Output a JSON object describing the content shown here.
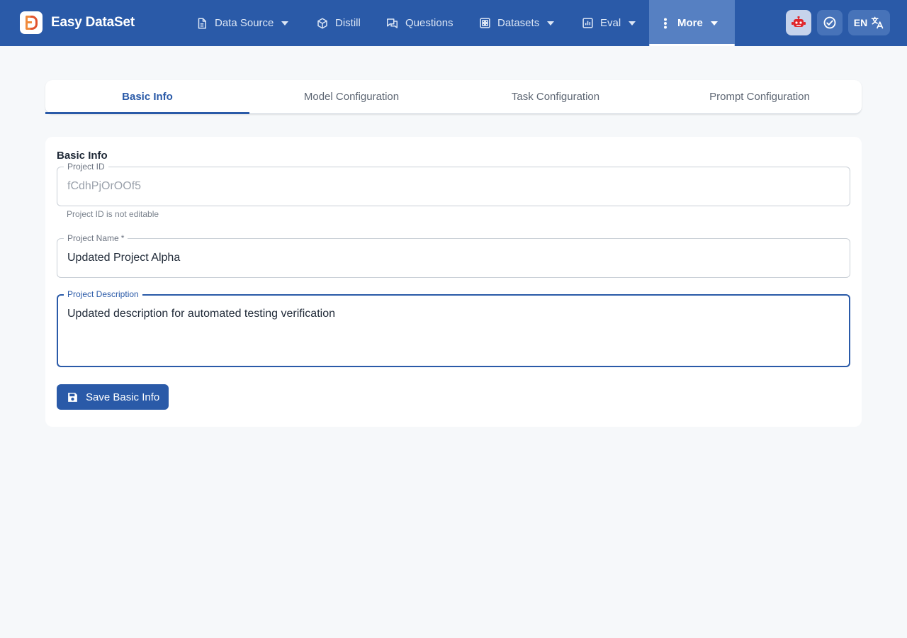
{
  "app": {
    "name": "Easy DataSet"
  },
  "nav": {
    "items": [
      {
        "label": "Data Source",
        "icon": "document-icon",
        "dropdown": true
      },
      {
        "label": "Distill",
        "icon": "cube-icon",
        "dropdown": false
      },
      {
        "label": "Questions",
        "icon": "chat-icon",
        "dropdown": false
      },
      {
        "label": "Datasets",
        "icon": "grid-icon",
        "dropdown": true
      },
      {
        "label": "Eval",
        "icon": "bar-chart-icon",
        "dropdown": true
      },
      {
        "label": "More",
        "icon": "vertical-dots-icon",
        "dropdown": true,
        "active": true
      }
    ],
    "language": "EN"
  },
  "tabs": [
    {
      "label": "Basic Info",
      "active": true
    },
    {
      "label": "Model Configuration",
      "active": false
    },
    {
      "label": "Task Configuration",
      "active": false
    },
    {
      "label": "Prompt Configuration",
      "active": false
    }
  ],
  "form": {
    "section_title": "Basic Info",
    "project_id": {
      "label": "Project ID",
      "value": "fCdhPjOrOOf5",
      "helper": "Project ID is not editable",
      "disabled": true
    },
    "project_name": {
      "label": "Project Name",
      "required_mark": "*",
      "value": "Updated Project Alpha"
    },
    "project_description": {
      "label": "Project Description",
      "value": "Updated description for automated testing verification",
      "focused": true
    },
    "save_label": "Save Basic Info"
  },
  "colors": {
    "primary": "#2a5aa8",
    "nav_active": "#5680c2",
    "background": "#f6f8fa",
    "logo_orange": "#f08a3c",
    "logo_red": "#e0522e",
    "robot_red": "#e0262b"
  }
}
